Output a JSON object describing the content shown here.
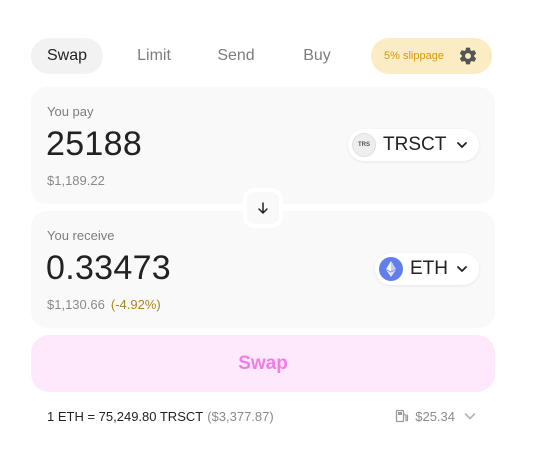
{
  "tabs": [
    {
      "label": "Swap",
      "active": true
    },
    {
      "label": "Limit",
      "active": false
    },
    {
      "label": "Send",
      "active": false
    },
    {
      "label": "Buy",
      "active": false
    }
  ],
  "slippage": {
    "label": "5% slippage",
    "icon": "gear-icon"
  },
  "pay": {
    "label": "You pay",
    "amount": "25188",
    "usd": "$1,189.22",
    "token": {
      "icon_text": "TRS",
      "symbol": "TRSCT"
    }
  },
  "receive": {
    "label": "You receive",
    "amount": "0.33473",
    "usd": "$1,130.66",
    "delta": "(-4.92%)",
    "token": {
      "symbol": "ETH",
      "icon": "ethereum-icon"
    }
  },
  "swap_button": {
    "label": "Swap"
  },
  "footer": {
    "rate": "1 ETH = 75,249.80 TRSCT",
    "rate_usd": "($3,377.87)",
    "gas": "$25.34"
  },
  "colors": {
    "accent_pink": "#f27ce8",
    "swap_bg": "#fde9fb",
    "slippage_bg": "#fcecc4",
    "slippage_text": "#d59a08",
    "delta_text": "#a78621",
    "eth_blue": "#627eea"
  }
}
